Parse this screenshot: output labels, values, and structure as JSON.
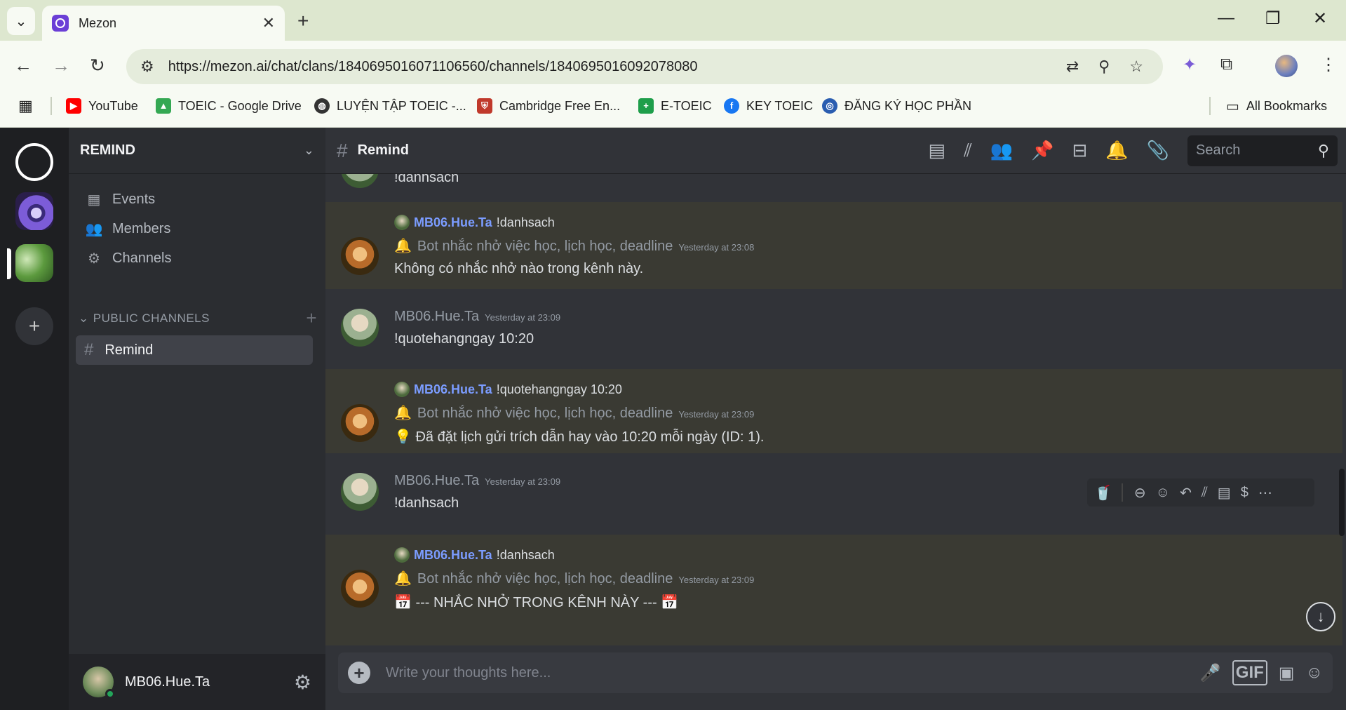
{
  "browser": {
    "tab_title": "Mezon",
    "url": "https://mezon.ai/chat/clans/1840695016071106560/channels/1840695016092078080",
    "bookmarks": [
      {
        "label": "YouTube",
        "color": "#ff0000"
      },
      {
        "label": "TOEIC - Google Drive",
        "color": "#34a853"
      },
      {
        "label": "LUYỆN TẬP TOEIC -...",
        "color": "#222222"
      },
      {
        "label": "Cambridge Free En...",
        "color": "#c0392b"
      },
      {
        "label": "E-TOEIC",
        "color": "#1e9e4a"
      },
      {
        "label": "KEY TOEIC",
        "color": "#1877f2"
      },
      {
        "label": "ĐĂNG KÝ HỌC PHẦN",
        "color": "#2a5db0"
      }
    ],
    "all_bookmarks": "All Bookmarks"
  },
  "sidebar": {
    "clan_name": "REMIND",
    "items": [
      {
        "label": "Events",
        "icon": "calendar-icon"
      },
      {
        "label": "Members",
        "icon": "members-icon"
      },
      {
        "label": "Channels",
        "icon": "gear-icon"
      }
    ],
    "category": "PUBLIC CHANNELS",
    "active_channel": "Remind",
    "user": "MB06.Hue.Ta"
  },
  "header": {
    "channel": "Remind",
    "search_placeholder": "Search"
  },
  "messages": [
    {
      "type": "user",
      "text": "!danhsach"
    },
    {
      "type": "bot",
      "reply_to": "MB06.Hue.Ta",
      "reply_text": "!danhsach",
      "author": "Bot nhắc nhở việc học, lịch học, deadline",
      "time": "Yesterday at 23:08",
      "text": "Không có nhắc nhở nào trong kênh này."
    },
    {
      "type": "user",
      "author": "MB06.Hue.Ta",
      "time": "Yesterday at 23:09",
      "text": "!quotehangngay 10:20"
    },
    {
      "type": "bot",
      "reply_to": "MB06.Hue.Ta",
      "reply_text": "!quotehangngay 10:20",
      "author": "Bot nhắc nhở việc học, lịch học, deadline",
      "time": "Yesterday at 23:09",
      "text": "💡 Đã đặt lịch gửi trích dẫn hay vào 10:20 mỗi ngày (ID: 1)."
    },
    {
      "type": "user",
      "author": "MB06.Hue.Ta",
      "time": "Yesterday at 23:09",
      "text": "!danhsach"
    },
    {
      "type": "bot",
      "reply_to": "MB06.Hue.Ta",
      "reply_text": "!danhsach",
      "author": "Bot nhắc nhở việc học, lịch học, deadline",
      "time": "Yesterday at 23:09",
      "text": "📅 --- NHẮC NHỞ TRONG KÊNH NÀY --- 📅"
    }
  ],
  "composer": {
    "placeholder": "Write your thoughts here..."
  }
}
